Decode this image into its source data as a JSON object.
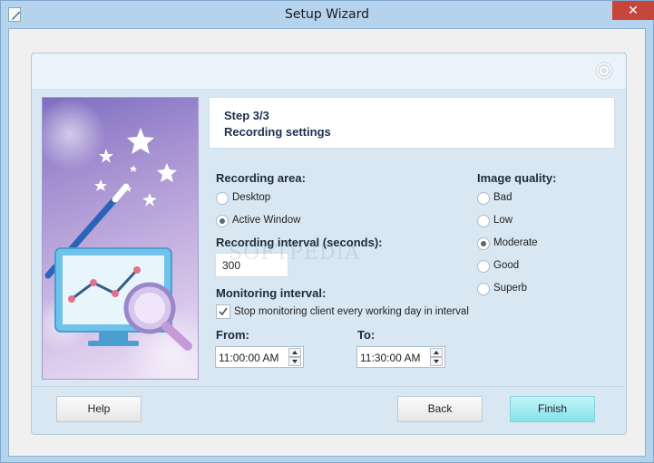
{
  "window": {
    "title": "Setup Wizard",
    "close_glyph": "✕"
  },
  "step": {
    "number": "Step 3/3",
    "name": "Recording settings"
  },
  "recording_area": {
    "label": "Recording area:",
    "options": [
      {
        "label": "Desktop",
        "checked": false
      },
      {
        "label": "Active Window",
        "checked": true
      }
    ]
  },
  "recording_interval": {
    "label": "Recording interval (seconds):",
    "value": "300"
  },
  "monitoring_interval": {
    "label": "Monitoring interval:",
    "stop_checkbox_label": "Stop monitoring client  every working day in interval",
    "stop_checked": true,
    "from_label": "From:",
    "from_value": "11:00:00 AM",
    "to_label": "To:",
    "to_value": "11:30:00 AM"
  },
  "image_quality": {
    "label": "Image quality:",
    "options": [
      {
        "label": "Bad",
        "checked": false
      },
      {
        "label": "Low",
        "checked": false
      },
      {
        "label": "Moderate",
        "checked": true
      },
      {
        "label": "Good",
        "checked": false
      },
      {
        "label": "Superb",
        "checked": false
      }
    ]
  },
  "buttons": {
    "help": "Help",
    "back": "Back",
    "finish": "Finish"
  },
  "watermark": "SOFTPEDIA",
  "icons": {
    "app": "pencil-document-icon",
    "header": "disc-icon",
    "art": "magic-wand-chart-magnifier-illustration"
  },
  "colors": {
    "titlebar": "#b6d3ee",
    "close_button": "#c7463b",
    "finish_button": "#86e3ea",
    "panel": "#d8e7f2"
  }
}
